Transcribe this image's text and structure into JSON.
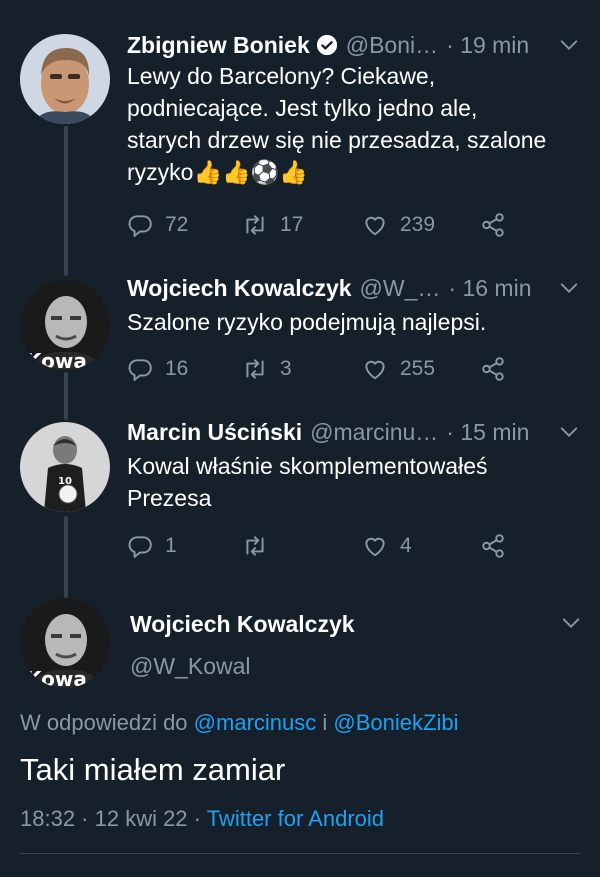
{
  "colors": {
    "background": "#15202b",
    "text": "#ffffff",
    "muted": "#8899a6",
    "link": "#1da1f2",
    "line": "#38444d"
  },
  "tweets": [
    {
      "name": "Zbigniew Boniek",
      "verified": true,
      "handle": "@Boni…",
      "time": "· 19 min",
      "text_lines": [
        "Lewy do Barcelony? Ciekawe,",
        "podniecające. Jest tylko jedno ale,",
        "starych drzew się nie przesadza, szalone",
        "ryzyko👍👍⚽👍"
      ],
      "replies": "72",
      "retweets": "17",
      "likes": "239"
    },
    {
      "name": "Wojciech Kowalczyk",
      "handle": "@W_…",
      "time": "· 16 min",
      "text_lines": [
        "Szalone ryzyko podejmują najlepsi."
      ],
      "replies": "16",
      "retweets": "3",
      "likes": "255"
    },
    {
      "name": "Marcin Uściński",
      "handle": "@marcinu…",
      "time": "· 15 min",
      "text_lines": [
        "Kowal właśnie skomplementowałeś",
        "Prezesa"
      ],
      "replies": "1",
      "retweets": "",
      "likes": "4"
    }
  ],
  "main_tweet": {
    "name": "Wojciech Kowalczyk",
    "handle": "@W_Kowal",
    "reply_prefix": "W odpowiedzi do",
    "mention1": "@marcinusc",
    "reply_join": "i",
    "mention2": "@BoniekZibi",
    "text": "Taki miałem zamiar",
    "date": "18:32 · 12 kwi 22 ·",
    "client": "Twitter for Android"
  },
  "icons": [
    "verified-icon",
    "chevron-down-icon",
    "reply-icon",
    "retweet-icon",
    "like-icon",
    "share-icon"
  ]
}
